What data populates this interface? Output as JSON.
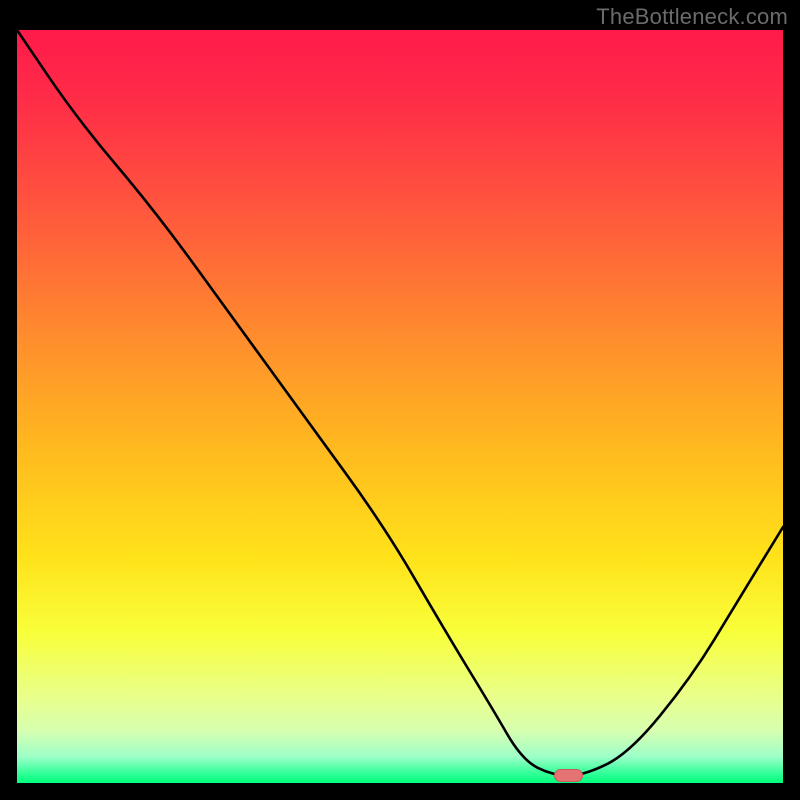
{
  "watermark": "TheBottleneck.com",
  "colors": {
    "frame_bg": "#000000",
    "watermark": "#6b6b6b",
    "curve": "#000000",
    "marker_fill": "#e57373",
    "marker_stroke": "#c85a5a",
    "gradient_stops": [
      {
        "offset": 0.0,
        "color": "#ff1a4b"
      },
      {
        "offset": 0.1,
        "color": "#ff2e47"
      },
      {
        "offset": 0.25,
        "color": "#ff5a3c"
      },
      {
        "offset": 0.4,
        "color": "#ff8a2e"
      },
      {
        "offset": 0.55,
        "color": "#ffb81f"
      },
      {
        "offset": 0.7,
        "color": "#ffe21a"
      },
      {
        "offset": 0.8,
        "color": "#f8ff3a"
      },
      {
        "offset": 0.88,
        "color": "#eaff85"
      },
      {
        "offset": 0.93,
        "color": "#d8ffb0"
      },
      {
        "offset": 0.965,
        "color": "#9dffc8"
      },
      {
        "offset": 0.985,
        "color": "#3bff9d"
      },
      {
        "offset": 1.0,
        "color": "#00ff7b"
      }
    ]
  },
  "chart_data": {
    "type": "line",
    "title": "",
    "xlabel": "",
    "ylabel": "",
    "xlim": [
      0,
      100
    ],
    "ylim": [
      0,
      100
    ],
    "grid": false,
    "series": [
      {
        "name": "bottleneck-curve",
        "x": [
          0,
          8,
          18,
          28,
          38,
          48,
          56,
          62,
          66,
          70,
          74,
          80,
          88,
          94,
          100
        ],
        "y": [
          100,
          88,
          76,
          62,
          48,
          34,
          20,
          10,
          3,
          1,
          1,
          4,
          14,
          24,
          34
        ]
      }
    ],
    "marker": {
      "name": "optimal-point",
      "x": 72,
      "y": 1
    },
    "legend": null
  }
}
